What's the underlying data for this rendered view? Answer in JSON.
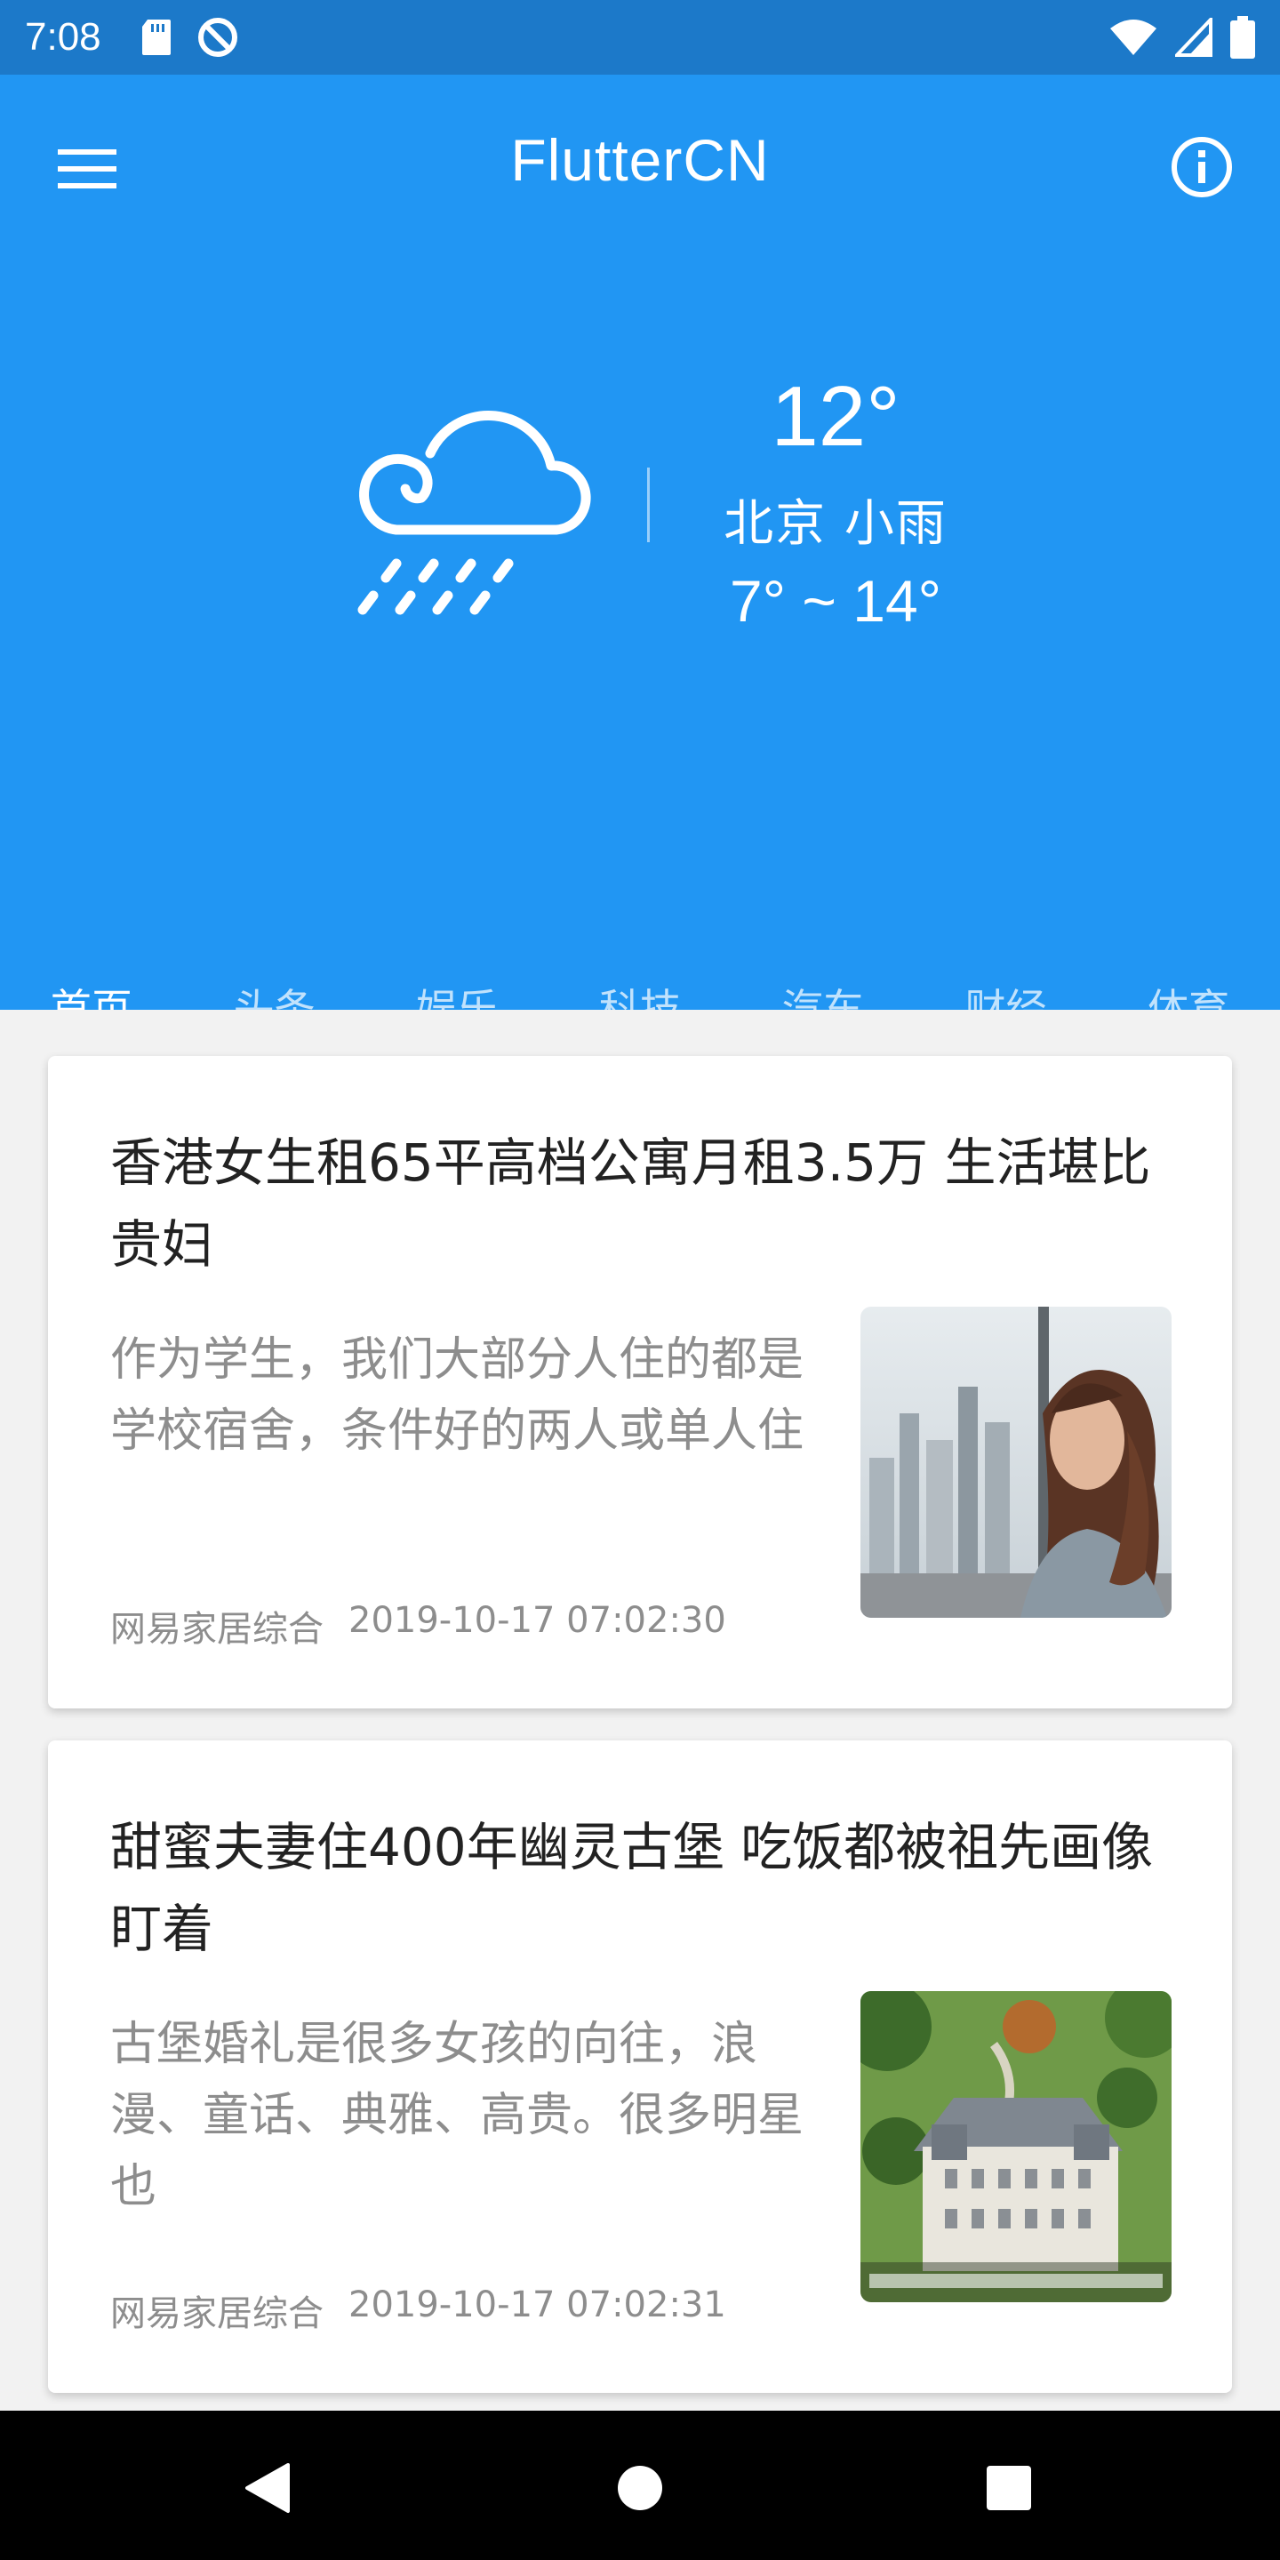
{
  "status_bar": {
    "time": "7:08"
  },
  "app_bar": {
    "title": "FlutterCN",
    "menu_icon": "menu-icon",
    "info_icon": "info-icon"
  },
  "weather": {
    "temperature": "12°",
    "description": "北京  小雨",
    "range": "7° ~ 14°",
    "icon": "cloud-rain-icon"
  },
  "tabs": [
    {
      "label": "首页",
      "active": true
    },
    {
      "label": "头条"
    },
    {
      "label": "娱乐"
    },
    {
      "label": "科技"
    },
    {
      "label": "汽车"
    },
    {
      "label": "财经"
    },
    {
      "label": "体育"
    }
  ],
  "articles": [
    {
      "title": "香港女生租65平高档公寓月租3.5万 生活堪比贵妇",
      "summary": "作为学生，我们大部分人住的都是学校宿舍，条件好的两人或单人住",
      "source": "网易家居综合",
      "time": "2019-10-17 07:02:30"
    },
    {
      "title": "甜蜜夫妻住400年幽灵古堡 吃饭都被祖先画像盯着",
      "summary": "古堡婚礼是很多女孩的向往，浪漫、童话、典雅、高贵。很多明星也",
      "source": "网易家居综合",
      "time": "2019-10-17 07:02:31"
    }
  ],
  "colors": {
    "primary": "#2196f3",
    "status_bar": "#1c79c9"
  }
}
